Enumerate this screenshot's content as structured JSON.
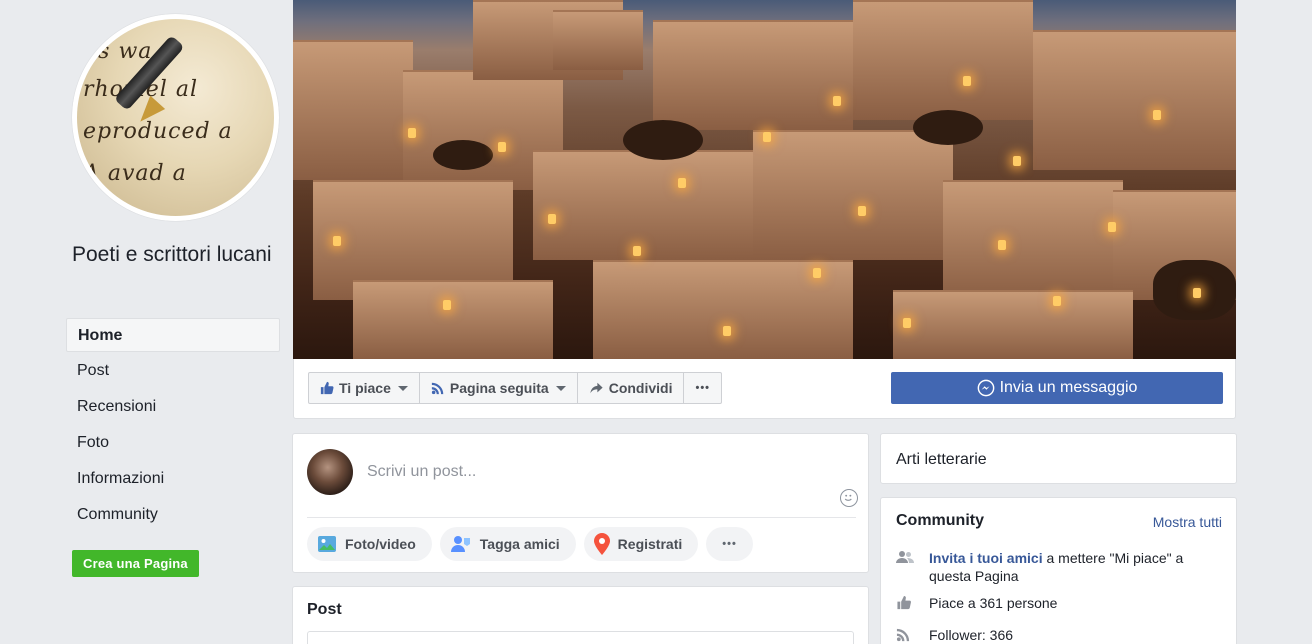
{
  "page": {
    "name": "Poeti e scrittori lucani"
  },
  "left_nav": {
    "items": [
      {
        "label": "Home",
        "active": true
      },
      {
        "label": "Post"
      },
      {
        "label": "Recensioni"
      },
      {
        "label": "Foto"
      },
      {
        "label": "Informazioni"
      },
      {
        "label": "Community"
      }
    ],
    "create_page_label": "Crea una Pagina"
  },
  "avatar": {
    "script_lines": [
      "ns wa",
      "rhomel al",
      "eproduced a",
      "A avad a"
    ]
  },
  "actions": {
    "like_label": "Ti piace",
    "follow_label": "Pagina seguita",
    "share_label": "Condividi",
    "more_label": "•••",
    "message_label": "Invia un messaggio"
  },
  "composer": {
    "placeholder": "Scrivi un post...",
    "photo_label": "Foto/video",
    "tag_label": "Tagga amici",
    "checkin_label": "Registrati",
    "more_label": "•••"
  },
  "posts": {
    "title": "Post"
  },
  "category": {
    "label": "Arti letterarie"
  },
  "community": {
    "title": "Community",
    "see_all": "Mostra tutti",
    "invite_link": "Invita i tuoi amici",
    "invite_rest": " a mettere \"Mi piace\" a questa Pagina",
    "likes": "Piace a 361 persone",
    "followers": "Follower: 366"
  },
  "colors": {
    "brand_blue": "#4267b2",
    "link_blue": "#385898",
    "create_green": "#42b72a",
    "background": "#e9ebee"
  }
}
